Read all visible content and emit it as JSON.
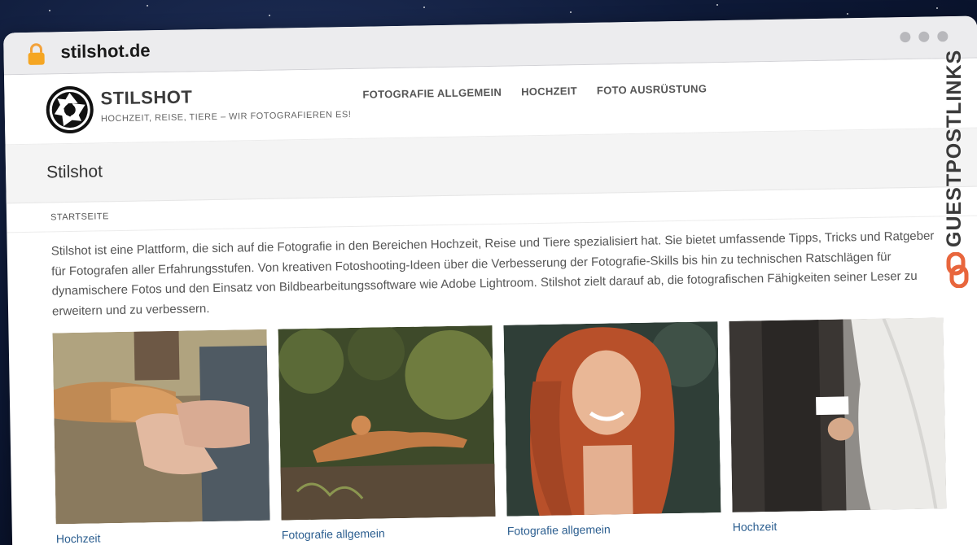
{
  "browser": {
    "url": "stilshot.de"
  },
  "site": {
    "title": "STILSHOT",
    "tagline": "HOCHZEIT, REISE, TIERE – WIR FOTOGRAFIEREN ES!",
    "nav": [
      {
        "label": "FOTOGRAFIE ALLGEMEIN"
      },
      {
        "label": "HOCHZEIT"
      },
      {
        "label": "FOTO AUSRÜSTUNG"
      }
    ]
  },
  "page": {
    "title": "Stilshot",
    "breadcrumb": "STARTSEITE",
    "intro": "Stilshot ist eine Plattform, die sich auf die Fotografie in den Bereichen Hochzeit, Reise und Tiere spezialisiert hat. Sie bietet umfassende Tipps, Tricks und Ratgeber für Fotografen aller Erfahrungsstufen. Von kreativen Fotoshooting-Ideen über die Verbesserung der Fotografie-Skills bis hin zu technischen Ratschlägen für dynamischere Fotos und den Einsatz von Bildbearbeitungssoftware wie Adobe Lightroom. Stilshot zielt darauf ab, die fotografischen Fähigkeiten seiner Leser zu erweitern und zu verbessern."
  },
  "cards": [
    {
      "label": "Hochzeit",
      "image": "hands-with-dog-paw"
    },
    {
      "label": "Fotografie allgemein",
      "image": "iguana-in-foliage"
    },
    {
      "label": "Fotografie allgemein",
      "image": "smiling-red-haired-woman"
    },
    {
      "label": "Hochzeit",
      "image": "wedding-couple-hands"
    }
  ],
  "watermark": {
    "text": "GUESTPOSTLINKS",
    "accent_color": "#e8663d"
  },
  "icons": {
    "lock": "lock-icon",
    "logo": "camera-aperture-logo"
  }
}
